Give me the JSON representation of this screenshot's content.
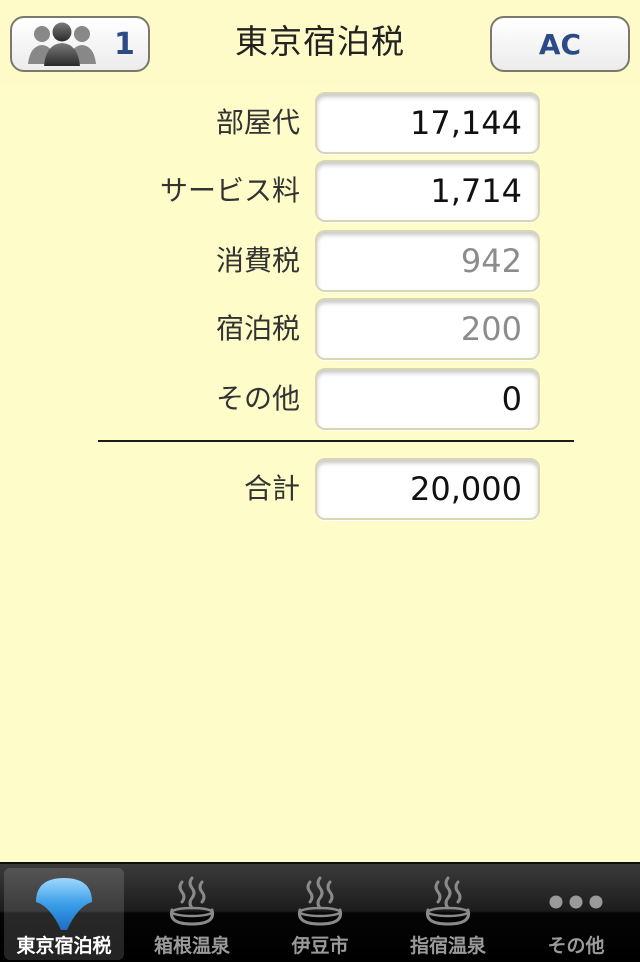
{
  "navbar": {
    "title": "東京宿泊税",
    "people_count": "1",
    "ac_label": "AC"
  },
  "form": {
    "rows": [
      {
        "label": "部屋代",
        "value": "17,144",
        "editable": true
      },
      {
        "label": "サービス料",
        "value": "1,714",
        "editable": true
      },
      {
        "label": "消費税",
        "value": "942",
        "editable": false
      },
      {
        "label": "宿泊税",
        "value": "200",
        "editable": false
      },
      {
        "label": "その他",
        "value": "0",
        "editable": true
      }
    ],
    "total": {
      "label": "合計",
      "value": "20,000"
    }
  },
  "tabbar": {
    "tabs": [
      {
        "label": "東京宿泊税",
        "icon": "tokyo-tower-icon",
        "selected": true
      },
      {
        "label": "箱根温泉",
        "icon": "hot-spring-icon",
        "selected": false
      },
      {
        "label": "伊豆市",
        "icon": "hot-spring-icon",
        "selected": false
      },
      {
        "label": "指宿温泉",
        "icon": "hot-spring-icon",
        "selected": false
      },
      {
        "label": "その他",
        "icon": "more-icon",
        "selected": false
      }
    ]
  },
  "colors": {
    "background": "#fefbc8",
    "button_text": "#2b4a86",
    "tab_selected_icon": "#4aa8e8"
  }
}
